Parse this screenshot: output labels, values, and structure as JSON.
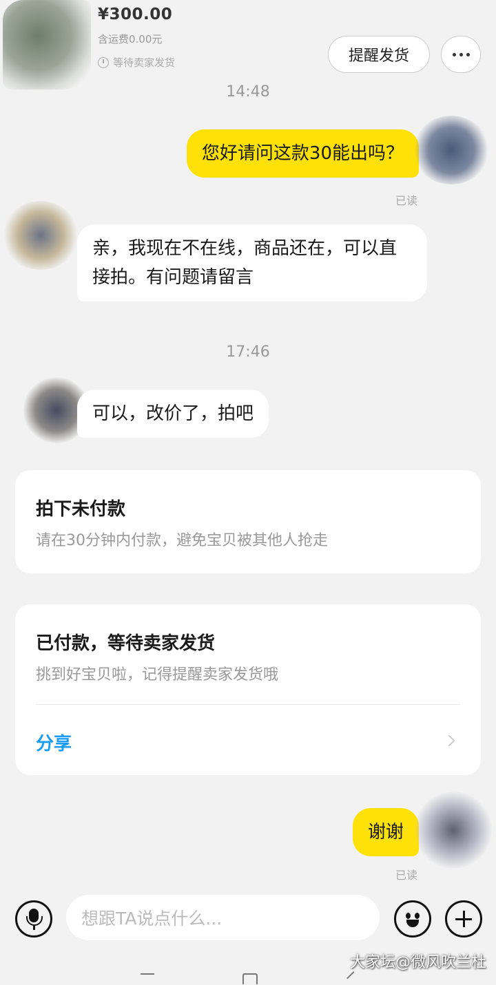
{
  "header": {
    "price": "¥300.00",
    "shipping": "含运费0.00元",
    "order_status": "等待卖家发货",
    "remind_button": "提醒发货"
  },
  "messages": [
    {
      "type": "time",
      "text": "14:48"
    },
    {
      "type": "mine",
      "text": "您好请问这款30能出吗？",
      "status": "已读"
    },
    {
      "type": "theirs",
      "text": "亲，我现在不在线，商品还在，可以直接拍。有问题请留言"
    },
    {
      "type": "time",
      "text": "17:46"
    },
    {
      "type": "theirs",
      "text": "可以，改价了，拍吧"
    },
    {
      "type": "mine",
      "text": "谢谢",
      "status": "已读"
    }
  ],
  "cards": {
    "unpaid": {
      "title": "拍下未付款",
      "subtitle": "请在30分钟内付款，避免宝贝被其他人抢走"
    },
    "paid": {
      "title": "已付款，等待卖家发货",
      "subtitle": "挑到好宝贝啦，记得提醒卖家发货哦",
      "link": "分享"
    }
  },
  "input": {
    "placeholder": "想跟TA说点什么..."
  },
  "watermark": "大家坛@微风吹兰杜",
  "icons": [
    "clock-icon",
    "more-icon",
    "chevron-right-icon",
    "microphone-icon",
    "emoji-icon",
    "plus-icon"
  ],
  "colors": {
    "my_bubble": "#ffe10a",
    "link": "#1a9cf0",
    "background": "#f2f2f2"
  }
}
